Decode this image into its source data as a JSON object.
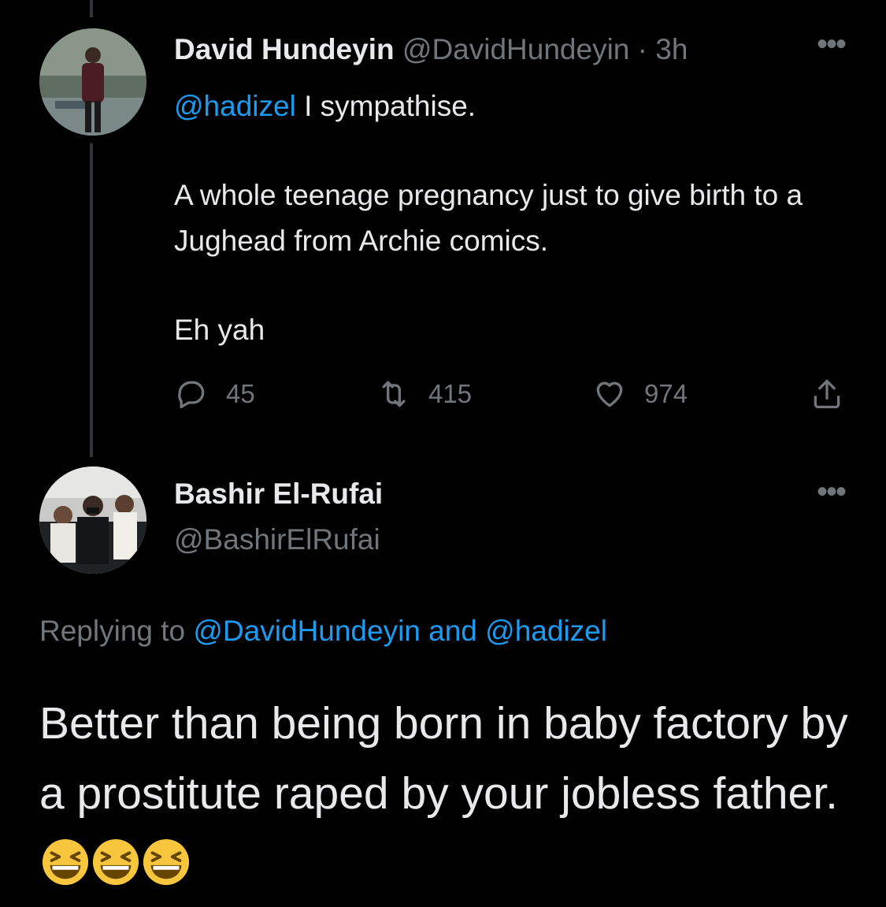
{
  "tweet1": {
    "author_name": "David Hundeyin",
    "handle": "@DavidHundeyin",
    "separator": "·",
    "time": "3h",
    "mention": "@hadizel",
    "line1_rest": " I sympathise.",
    "paragraph2": "A whole teenage pregnancy just to give birth to a Jughead from Archie comics.",
    "paragraph3": "Eh yah",
    "reply_count": "45",
    "retweet_count": "415",
    "like_count": "974",
    "more_icon": "•••"
  },
  "tweet2": {
    "author_name": "Bashir El-Rufai",
    "handle": "@BashirElRufai",
    "more_icon": "•••",
    "replying_prefix": "Replying to ",
    "replying_mention1": "@DavidHundeyin",
    "replying_and": " and ",
    "replying_mention2": "@hadizel",
    "body": "Better than being born in baby factory by a prostitute raped by your jobless father. ",
    "emoji_name": "grinning-squinting-face"
  },
  "colors": {
    "background": "#000000",
    "text": "#e7e9ea",
    "muted": "#71767b",
    "link": "#1d9bf0",
    "thread_line": "#333639"
  }
}
